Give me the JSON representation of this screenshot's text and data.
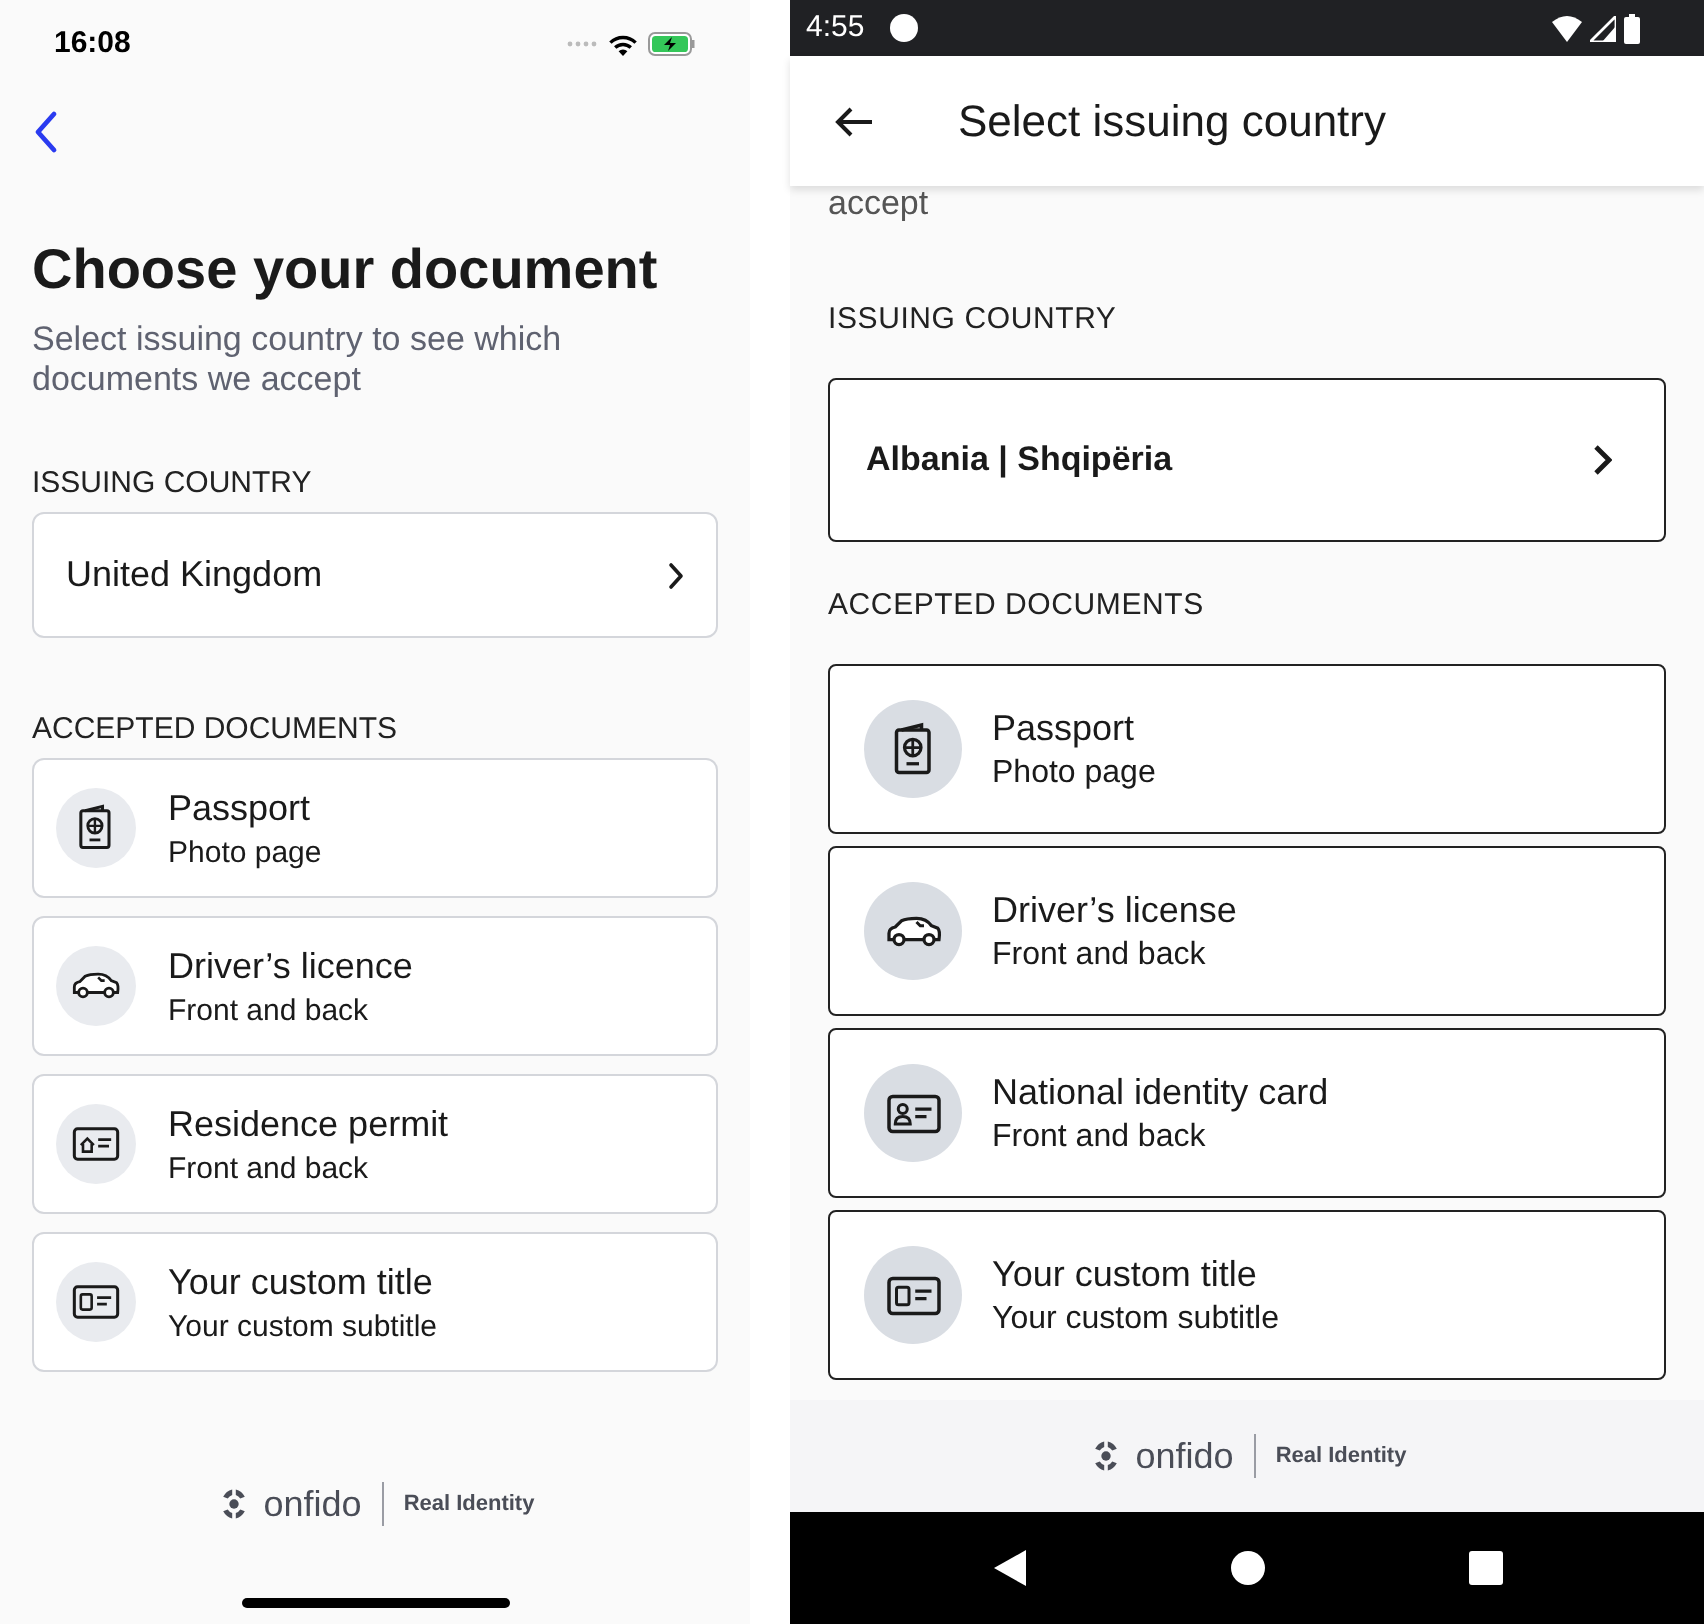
{
  "ios": {
    "status_bar": {
      "time": "16:08"
    },
    "title": "Choose your document",
    "subtitle": "Select issuing country to see which documents we accept",
    "country_label": "ISSUING COUNTRY",
    "country": "United Kingdom",
    "documents_label": "ACCEPTED DOCUMENTS",
    "documents": [
      {
        "kind": "passport",
        "title": "Passport",
        "subtitle": "Photo page"
      },
      {
        "kind": "car",
        "title": "Driver’s licence",
        "subtitle": "Front and back"
      },
      {
        "kind": "residence",
        "title": "Residence permit",
        "subtitle": "Front and back"
      },
      {
        "kind": "card",
        "title": "Your custom title",
        "subtitle": "Your custom subtitle"
      }
    ],
    "footer": {
      "brand": "onfido",
      "tagline": "Real Identity"
    }
  },
  "android": {
    "status_bar": {
      "time": "4:55"
    },
    "app_bar": {
      "title": "Select issuing country"
    },
    "scrolled_text": "accept",
    "country_label": "ISSUING COUNTRY",
    "country": "Albania | Shqipëria",
    "documents_label": "ACCEPTED DOCUMENTS",
    "documents": [
      {
        "kind": "passport",
        "title": "Passport",
        "subtitle": "Photo page"
      },
      {
        "kind": "car",
        "title": "Driver’s license",
        "subtitle": "Front and back"
      },
      {
        "kind": "id",
        "title": "National identity card",
        "subtitle": "Front and back"
      },
      {
        "kind": "card",
        "title": "Your custom title",
        "subtitle": "Your custom subtitle"
      }
    ],
    "footer": {
      "brand": "onfido",
      "tagline": "Real Identity"
    }
  }
}
